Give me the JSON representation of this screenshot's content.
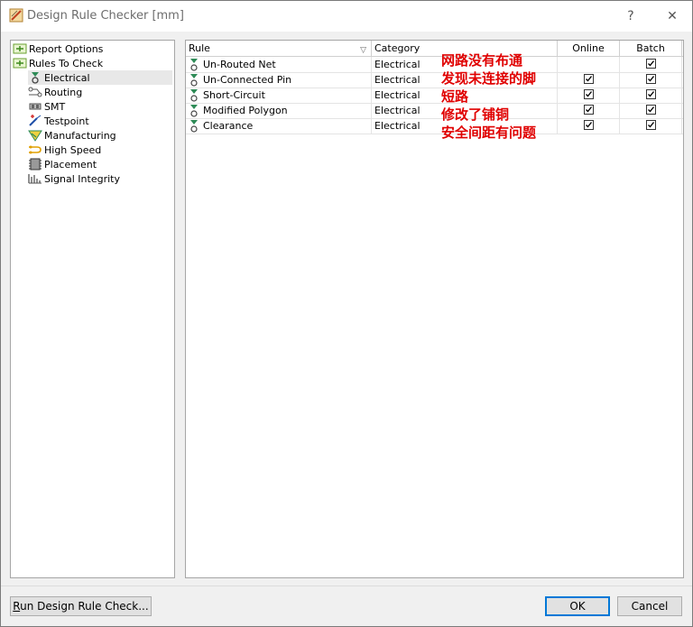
{
  "window": {
    "title": "Design Rule Checker [mm]",
    "help_label": "?",
    "close_label": "✕"
  },
  "tree": {
    "items": [
      {
        "label": "Report Options",
        "icon": "report-options-icon",
        "level": 0
      },
      {
        "label": "Rules To Check",
        "icon": "rules-to-check-icon",
        "level": 0
      },
      {
        "label": "Electrical",
        "icon": "electrical-icon",
        "level": 1,
        "selected": true
      },
      {
        "label": "Routing",
        "icon": "routing-icon",
        "level": 1
      },
      {
        "label": "SMT",
        "icon": "smt-icon",
        "level": 1
      },
      {
        "label": "Testpoint",
        "icon": "testpoint-icon",
        "level": 1
      },
      {
        "label": "Manufacturing",
        "icon": "manufacturing-icon",
        "level": 1
      },
      {
        "label": "High Speed",
        "icon": "high-speed-icon",
        "level": 1
      },
      {
        "label": "Placement",
        "icon": "placement-icon",
        "level": 1
      },
      {
        "label": "Signal Integrity",
        "icon": "signal-integrity-icon",
        "level": 1
      }
    ]
  },
  "grid": {
    "columns": [
      "Rule",
      "Category",
      "Online",
      "Batch"
    ],
    "rows": [
      {
        "rule": "Un-Routed Net",
        "category": "Electrical",
        "online": false,
        "batch": true
      },
      {
        "rule": "Un-Connected Pin",
        "category": "Electrical",
        "online": true,
        "batch": true
      },
      {
        "rule": "Short-Circuit",
        "category": "Electrical",
        "online": true,
        "batch": true
      },
      {
        "rule": "Modified Polygon",
        "category": "Electrical",
        "online": true,
        "batch": true
      },
      {
        "rule": "Clearance",
        "category": "Electrical",
        "online": true,
        "batch": true
      }
    ]
  },
  "annotations": [
    "网路没有布通",
    "发现未连接的脚",
    "短路",
    "修改了铺铜",
    "安全间距有问题"
  ],
  "buttons": {
    "run_prefix": "R",
    "run_rest": "un Design Rule Check...",
    "ok": "OK",
    "cancel": "Cancel"
  },
  "colors": {
    "annotation": "#e00000",
    "primary_border": "#0078d7"
  }
}
